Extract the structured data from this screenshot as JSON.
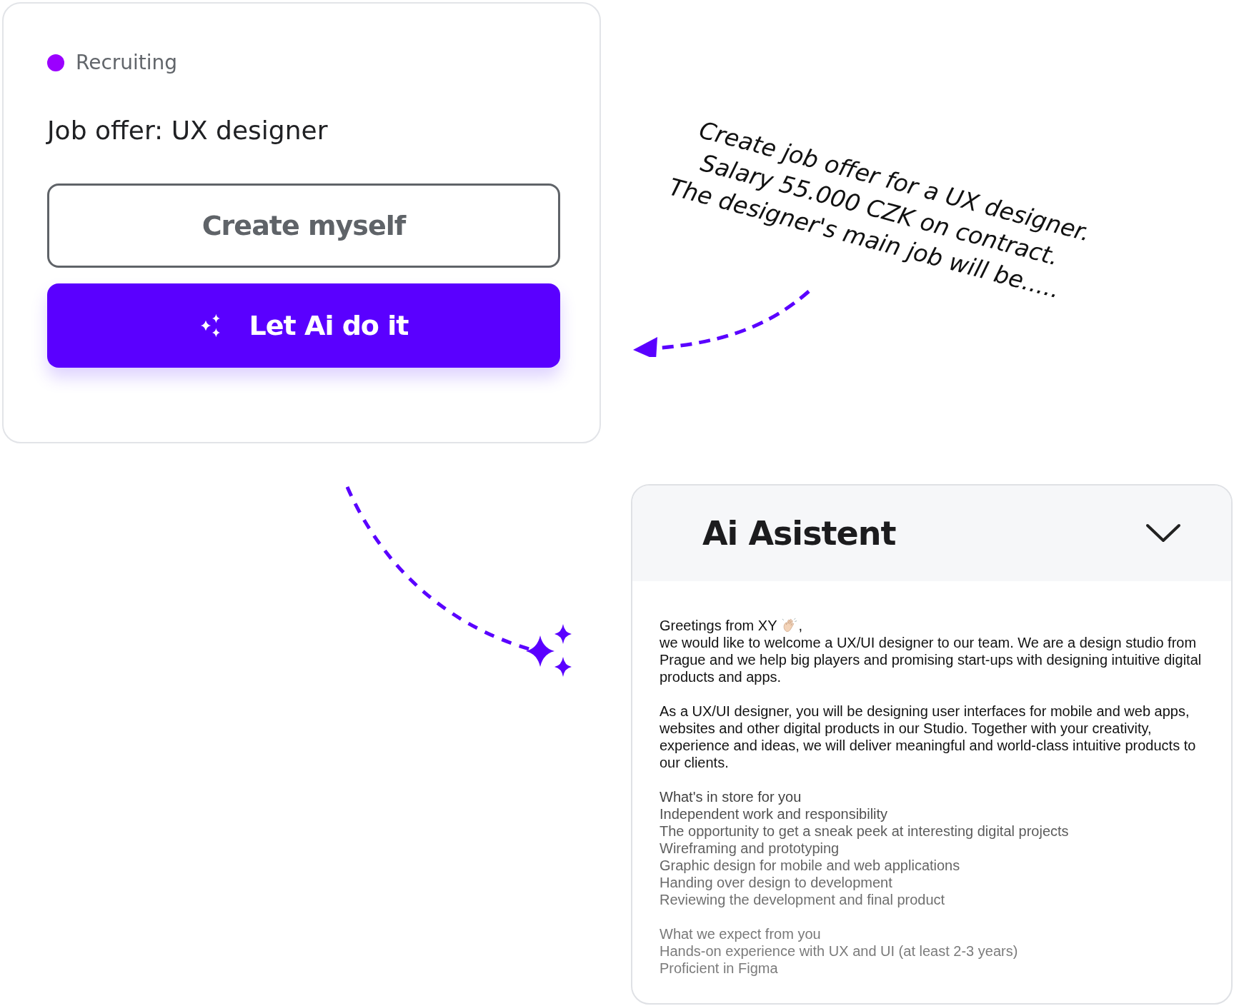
{
  "job_card": {
    "status": {
      "label": "Recruiting",
      "color": "#9b00ff"
    },
    "title": "Job offer: UX designer",
    "buttons": [
      {
        "label": "Create myself",
        "kind": "outline"
      },
      {
        "label": "Let Ai do it",
        "kind": "primary"
      }
    ]
  },
  "prompt_note": {
    "lines": [
      "Create job offer for a UX designer.",
      "Salary 55.000 CZK on contract.",
      "The designer's main job will be....."
    ]
  },
  "assistant_panel": {
    "title": "Ai Asistent",
    "expanded": true,
    "greeting": "Greetings from XY",
    "greeting_end": ",",
    "paragraphs": [
      "we would like to welcome a UX/UI designer to our team. We are a design studio from Prague and we help big players and promising start-ups with designing intuitive digital products and apps.",
      "As a UX/UI designer, you will be designing user interfaces for mobile and web apps, websites and other digital products in our Studio. Together with your creativity, experience and ideas, we will deliver meaningful and world-class intuitive products to our clients."
    ],
    "sections": [
      {
        "heading": "What's in store for you",
        "items": [
          "Independent work and responsibility",
          "The opportunity to get a sneak peek at interesting digital projects",
          "Wireframing and prototyping",
          "Graphic design for mobile and web applications",
          "Handing over design to development",
          "Reviewing the development and final product"
        ]
      },
      {
        "heading": "What we expect from you",
        "items": [
          "Hands-on experience with UX and UI (at least 2-3 years)",
          "Proficient in Figma"
        ]
      }
    ]
  }
}
